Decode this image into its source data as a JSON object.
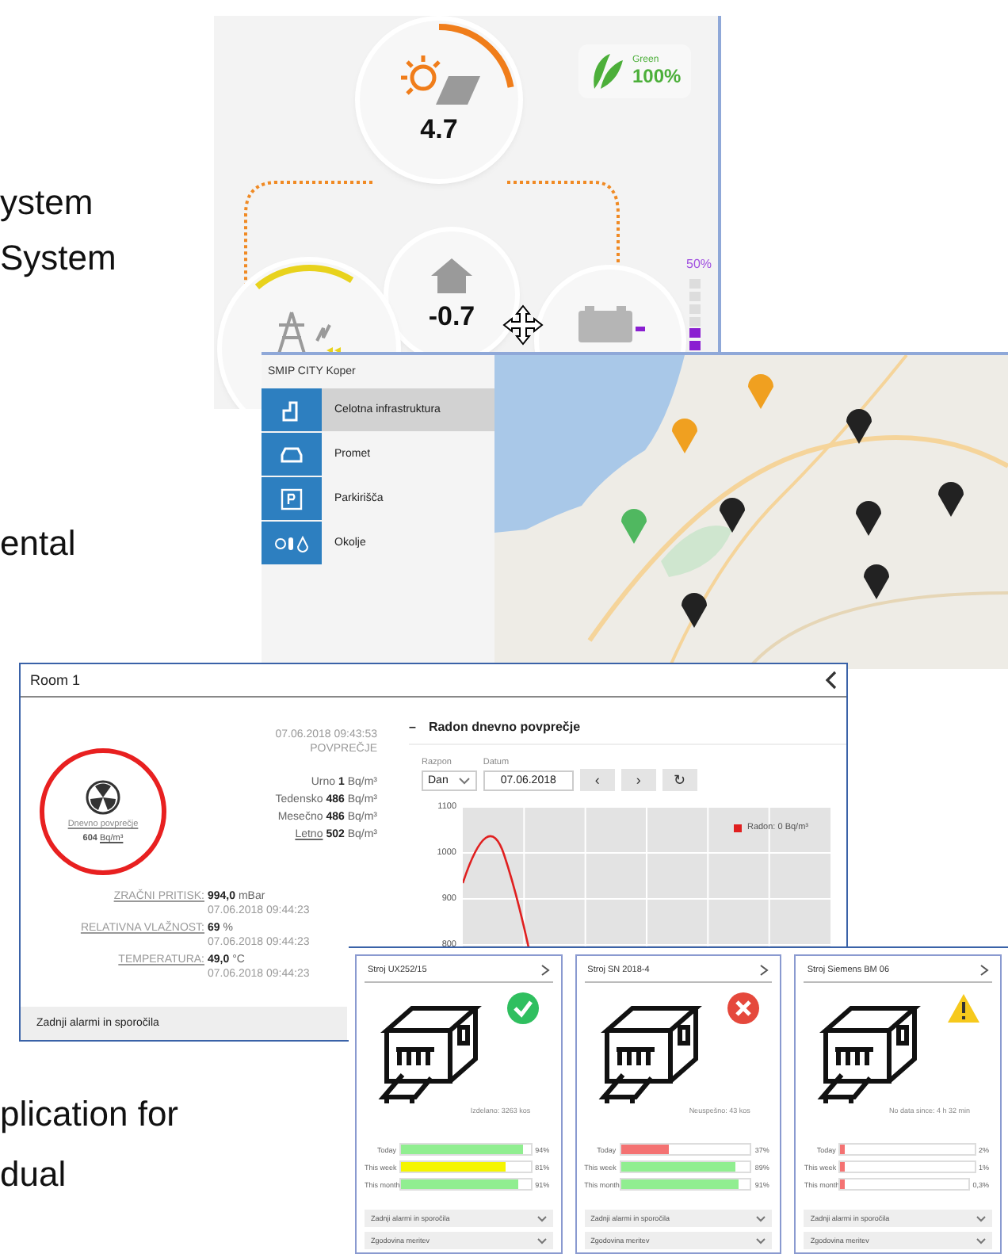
{
  "slide_text": [
    {
      "text": "ystem"
    },
    {
      "text": "System"
    },
    {
      "text": "ental"
    },
    {
      "text": "plication for"
    },
    {
      "text": "dual"
    }
  ],
  "energy": {
    "solar": {
      "value": "4.7"
    },
    "house": {
      "value": "-0.7"
    },
    "battery": {
      "reading": "50%",
      "level": 0.5
    },
    "green": {
      "label": "Green",
      "value": "100%"
    }
  },
  "map": {
    "title": "SMIP CITY Koper",
    "items": [
      {
        "label": "Celotna infrastruktura",
        "kind": "infrastructure",
        "selected": true
      },
      {
        "label": "Promet",
        "kind": "traffic",
        "selected": false
      },
      {
        "label": "Parkirišča",
        "kind": "parking",
        "selected": false
      },
      {
        "label": "Okolje",
        "kind": "environment",
        "selected": false
      }
    ]
  },
  "room": {
    "title": "Room 1",
    "gauge": {
      "label": "Dnevno povprečje",
      "value": "604",
      "unit": "Bq/m³"
    },
    "timestamp": "07.06.2018 09:43:53",
    "heading": "POVPREČJE",
    "averages": [
      {
        "label": "Urno",
        "value": "1",
        "unit": "Bq/m³"
      },
      {
        "label": "Tedensko",
        "value": "486",
        "unit": "Bq/m³"
      },
      {
        "label": "Mesečno",
        "value": "486",
        "unit": "Bq/m³"
      },
      {
        "label": "Letno",
        "value": "502",
        "unit": "Bq/m³"
      }
    ],
    "measurements": [
      {
        "label": "ZRAČNI PRITISK:",
        "value": "994,0",
        "unit": "mBar",
        "time": "07.06.2018 09:44:23"
      },
      {
        "label": "RELATIVNA VLAŽNOST:",
        "value": "69",
        "unit": "%",
        "time": "07.06.2018 09:44:23"
      },
      {
        "label": "TEMPERATURA:",
        "value": "49,0",
        "unit": "°C",
        "time": "07.06.2018 09:44:23"
      }
    ],
    "footer": "Zadnji alarmi in sporočila",
    "chart_panel": {
      "title": "Radon dnevno povprečje",
      "collapse": "–",
      "range_label": "Razpon",
      "range_value": "Dan",
      "date_label": "Datum",
      "date_value": "07.06.2018",
      "prev": "‹",
      "next": "›",
      "refresh": "↻",
      "y_labels": [
        "1100",
        "1000",
        "900",
        "800"
      ],
      "legend": "Radon: 0 Bq/m³"
    }
  },
  "machines": [
    {
      "title": "Stroj UX252/15",
      "kind": "ok",
      "caption": "Izdelano: 3263 kos",
      "bars": [
        {
          "label": "Today",
          "reading": "94%",
          "level": 0.94,
          "color": "#90ee90"
        },
        {
          "label": "This week",
          "reading": "81%",
          "level": 0.81,
          "color": "#f5f500"
        },
        {
          "label": "This month",
          "reading": "91%",
          "level": 0.91,
          "color": "#90ee90"
        }
      ],
      "menus": [
        "Zadnji alarmi in sporočila",
        "Zgodovina meritev"
      ]
    },
    {
      "title": "Stroj SN 2018-4",
      "kind": "error",
      "caption": "Neuspešno: 43 kos",
      "bars": [
        {
          "label": "Today",
          "reading": "37%",
          "level": 0.37,
          "color": "#f47272"
        },
        {
          "label": "This week",
          "reading": "89%",
          "level": 0.89,
          "color": "#90ee90"
        },
        {
          "label": "This month",
          "reading": "91%",
          "level": 0.91,
          "color": "#90ee90"
        }
      ],
      "menus": [
        "Zadnji alarmi in sporočila",
        "Zgodovina meritev"
      ]
    },
    {
      "title": "Stroj Siemens BM 06",
      "kind": "warning",
      "caption": "No data since: 4 h 32 min",
      "bars": [
        {
          "label": "Today",
          "reading": "2%",
          "level": 0.02,
          "color": "#f47272"
        },
        {
          "label": "This week",
          "reading": "1%",
          "level": 0.01,
          "color": "#f47272"
        },
        {
          "label": "This month",
          "reading": "0,3%",
          "level": 0.003,
          "color": "#f47272"
        }
      ],
      "menus": [
        "Zadnji alarmi in sporočila",
        "Zgodovina meritev"
      ]
    }
  ]
}
